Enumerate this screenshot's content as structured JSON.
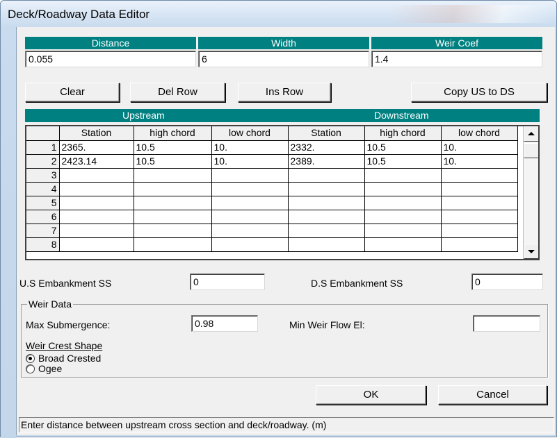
{
  "window": {
    "title": "Deck/Roadway Data Editor"
  },
  "top_fields": [
    {
      "header": "Distance",
      "value": "0.055"
    },
    {
      "header": "Width",
      "value": "6"
    },
    {
      "header": "Weir Coef",
      "value": "1.4"
    }
  ],
  "toolbar": {
    "clear": "Clear",
    "del_row": "Del Row",
    "ins_row": "Ins Row",
    "copy_us_ds": "Copy US to DS"
  },
  "sections": {
    "upstream": "Upstream",
    "downstream": "Downstream"
  },
  "table": {
    "columns": [
      "Station",
      "high chord",
      "low chord",
      "Station",
      "high chord",
      "low chord"
    ],
    "rows": [
      {
        "num": "1",
        "cells": [
          "2365.",
          "10.5",
          "10.",
          "2332.",
          "10.5",
          "10."
        ]
      },
      {
        "num": "2",
        "cells": [
          "2423.14",
          "10.5",
          "10.",
          "2389.",
          "10.5",
          "10."
        ]
      },
      {
        "num": "3",
        "cells": [
          "",
          "",
          "",
          "",
          "",
          ""
        ]
      },
      {
        "num": "4",
        "cells": [
          "",
          "",
          "",
          "",
          "",
          ""
        ]
      },
      {
        "num": "5",
        "cells": [
          "",
          "",
          "",
          "",
          "",
          ""
        ]
      },
      {
        "num": "6",
        "cells": [
          "",
          "",
          "",
          "",
          "",
          ""
        ]
      },
      {
        "num": "7",
        "cells": [
          "",
          "",
          "",
          "",
          "",
          ""
        ]
      },
      {
        "num": "8",
        "cells": [
          "",
          "",
          "",
          "",
          "",
          ""
        ]
      }
    ]
  },
  "embankment": {
    "us_label": "U.S Embankment SS",
    "us_value": "0",
    "ds_label": "D.S Embankment SS",
    "ds_value": "0"
  },
  "weir_data": {
    "group_label": "Weir Data",
    "max_submergence_label": "Max  Submergence:",
    "max_submergence_value": "0.98",
    "min_weir_flow_label": "Min Weir Flow El:",
    "min_weir_flow_value": "",
    "crest_shape_label": "Weir Crest Shape",
    "options": [
      {
        "label": "Broad Crested",
        "selected": true
      },
      {
        "label": "Ogee",
        "selected": false
      }
    ]
  },
  "buttons": {
    "ok": "OK",
    "cancel": "Cancel"
  },
  "status_text": "Enter distance between upstream cross section and deck/roadway. (m)",
  "colors": {
    "header_bg": "#008080",
    "header_text": "#ffffff",
    "dialog_bg": "#f0f0f0"
  }
}
